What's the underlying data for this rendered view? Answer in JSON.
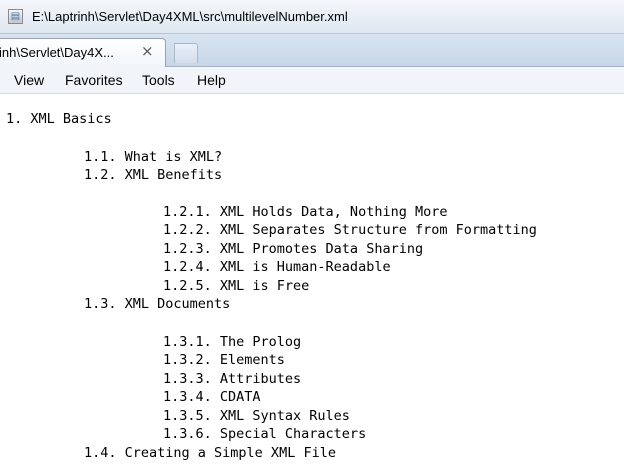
{
  "address_bar": {
    "path": "E:\\Laptrinh\\Servlet\\Day4XML\\src\\multilevelNumber.xml"
  },
  "tab": {
    "title": "inh\\Servlet\\Day4X...",
    "close_glyph": "×"
  },
  "menu": {
    "items": [
      "View",
      "Favorites",
      "Tools",
      "Help"
    ]
  },
  "document": {
    "lines": [
      "1. XML Basics",
      "1.1. What is XML?",
      "1.2. XML Benefits",
      "1.2.1. XML Holds Data, Nothing More",
      "1.2.2. XML Separates Structure from Formatting",
      "1.2.3. XML Promotes Data Sharing",
      "1.2.4. XML is Human-Readable",
      "1.2.5. XML is Free",
      "1.3. XML Documents",
      "1.3.1. The Prolog",
      "1.3.2. Elements",
      "1.3.3. Attributes",
      "1.3.4. CDATA",
      "1.3.5. XML Syntax Rules",
      "1.3.6. Special Characters",
      "1.4. Creating a Simple XML File"
    ]
  }
}
